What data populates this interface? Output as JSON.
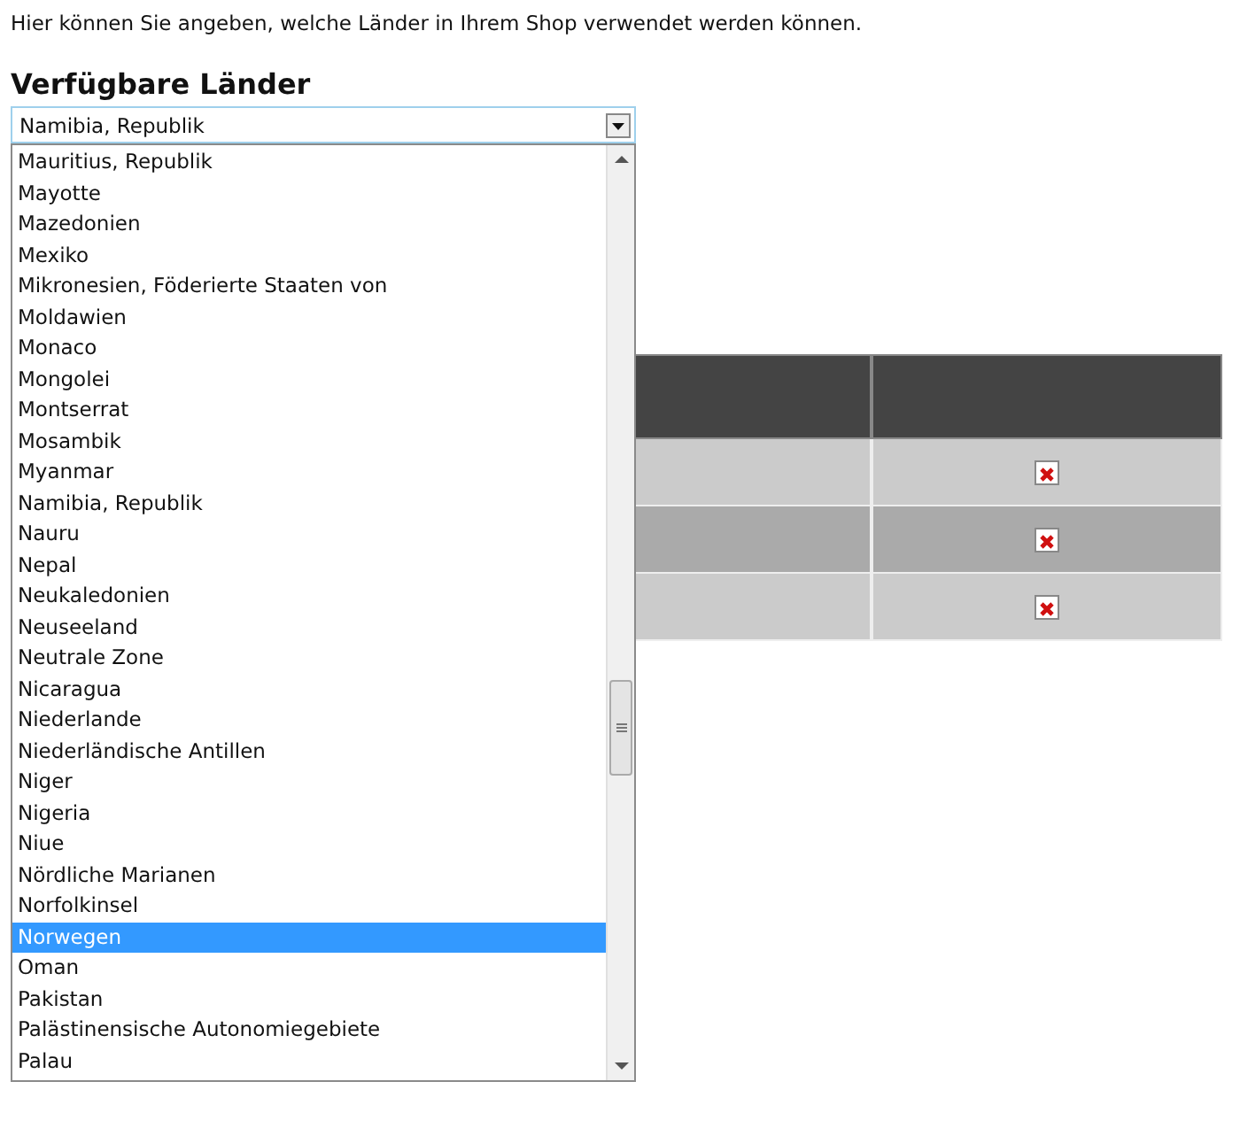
{
  "intro": "Hier können Sie angeben, welche Länder in Ihrem Shop verwendet werden können.",
  "heading": "Verfügbare Länder",
  "select": {
    "value": "Namibia, Republik",
    "expanded": true
  },
  "options": [
    {
      "label": "Mauritius, Republik",
      "selected": false
    },
    {
      "label": "Mayotte",
      "selected": false
    },
    {
      "label": "Mazedonien",
      "selected": false
    },
    {
      "label": "Mexiko",
      "selected": false
    },
    {
      "label": "Mikronesien, Föderierte Staaten von",
      "selected": false
    },
    {
      "label": "Moldawien",
      "selected": false
    },
    {
      "label": "Monaco",
      "selected": false
    },
    {
      "label": "Mongolei",
      "selected": false
    },
    {
      "label": "Montserrat",
      "selected": false
    },
    {
      "label": "Mosambik",
      "selected": false
    },
    {
      "label": "Myanmar",
      "selected": false
    },
    {
      "label": "Namibia, Republik",
      "selected": false
    },
    {
      "label": "Nauru",
      "selected": false
    },
    {
      "label": "Nepal",
      "selected": false
    },
    {
      "label": "Neukaledonien",
      "selected": false
    },
    {
      "label": "Neuseeland",
      "selected": false
    },
    {
      "label": "Neutrale Zone",
      "selected": false
    },
    {
      "label": "Nicaragua",
      "selected": false
    },
    {
      "label": "Niederlande",
      "selected": false
    },
    {
      "label": "Niederländische Antillen",
      "selected": false
    },
    {
      "label": "Niger",
      "selected": false
    },
    {
      "label": "Nigeria",
      "selected": false
    },
    {
      "label": "Niue",
      "selected": false
    },
    {
      "label": "Nördliche Marianen",
      "selected": false
    },
    {
      "label": "Norfolkinsel",
      "selected": false
    },
    {
      "label": "Norwegen",
      "selected": true
    },
    {
      "label": "Oman",
      "selected": false
    },
    {
      "label": "Pakistan",
      "selected": false
    },
    {
      "label": "Palästinensische Autonomiegebiete",
      "selected": false
    },
    {
      "label": "Palau",
      "selected": false
    }
  ],
  "table": {
    "rows": [
      {
        "kind": "deletable"
      },
      {
        "kind": "deletable"
      },
      {
        "kind": "deletable"
      }
    ]
  }
}
